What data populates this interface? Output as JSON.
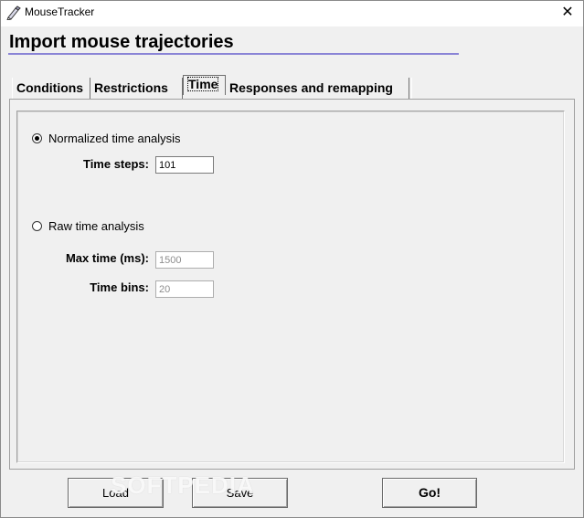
{
  "window": {
    "title": "MouseTracker",
    "close_glyph": "✕"
  },
  "heading": "Import mouse trajectories",
  "tabs": [
    {
      "label": "Conditions",
      "active": false
    },
    {
      "label": "Restrictions",
      "active": false
    },
    {
      "label": "Time",
      "active": true
    },
    {
      "label": "Responses and remapping",
      "active": false
    }
  ],
  "time_panel": {
    "normalized": {
      "label": "Normalized time analysis",
      "selected": true,
      "time_steps_label": "Time steps:",
      "time_steps_value": "101"
    },
    "raw": {
      "label": "Raw time analysis",
      "selected": false,
      "max_time_label": "Max time (ms):",
      "max_time_value": "1500",
      "time_bins_label": "Time bins:",
      "time_bins_value": "20"
    }
  },
  "buttons": {
    "load": "Load",
    "save": "Save",
    "go": "Go!"
  },
  "watermark": "SOFTPEDIA",
  "colors": {
    "heading_underline": "#8a84d6",
    "window_bg": "#f0f0f0"
  }
}
